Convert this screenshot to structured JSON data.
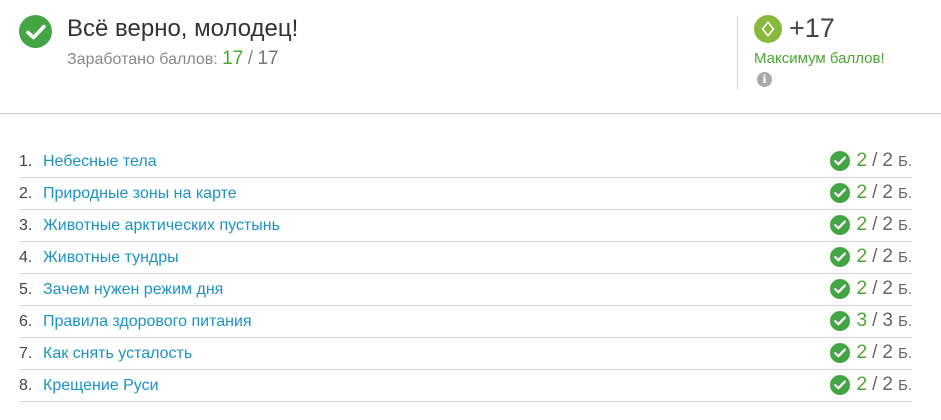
{
  "result": {
    "title": "Всё верно, молодец!",
    "earned_label": "Заработано баллов:",
    "earned": "17",
    "separator": "/",
    "total": "17"
  },
  "bonus": {
    "points": "+17",
    "max_label": "Максимум баллов!",
    "info_glyph": "i"
  },
  "topics": [
    {
      "num": "1.",
      "name": "Небесные тела",
      "earned": "2",
      "total": "2",
      "unit": "Б."
    },
    {
      "num": "2.",
      "name": "Природные зоны на карте",
      "earned": "2",
      "total": "2",
      "unit": "Б."
    },
    {
      "num": "3.",
      "name": "Животные арктических пустынь",
      "earned": "2",
      "total": "2",
      "unit": "Б."
    },
    {
      "num": "4.",
      "name": "Животные тундры",
      "earned": "2",
      "total": "2",
      "unit": "Б."
    },
    {
      "num": "5.",
      "name": "Зачем нужен режим дня",
      "earned": "2",
      "total": "2",
      "unit": "Б."
    },
    {
      "num": "6.",
      "name": "Правила здорового питания",
      "earned": "3",
      "total": "3",
      "unit": "Б."
    },
    {
      "num": "7.",
      "name": "Как снять усталость",
      "earned": "2",
      "total": "2",
      "unit": "Б."
    },
    {
      "num": "8.",
      "name": "Крещение Руси",
      "earned": "2",
      "total": "2",
      "unit": "Б."
    }
  ],
  "icons": {
    "success": "check-circle-icon",
    "bonus": "gem-icon",
    "info": "info-icon"
  },
  "colors": {
    "success_green": "#44a544",
    "score_green": "#4aa72f",
    "link_blue": "#1b93c9",
    "gem_green": "#8ab83a"
  }
}
